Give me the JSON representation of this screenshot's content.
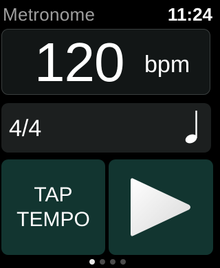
{
  "status_bar": {
    "app_title": "Metronome",
    "time": "11:24"
  },
  "tempo": {
    "value": "120",
    "unit": "bpm"
  },
  "time_signature": {
    "value": "4/4",
    "note_icon": "quarter-note-icon"
  },
  "controls": {
    "tap_tempo_line1": "TAP",
    "tap_tempo_line2": "TEMPO",
    "play_icon": "play-icon"
  },
  "pagination": {
    "page_count": 4,
    "active_page": 1
  },
  "colors": {
    "title_gray": "#9e9e9e",
    "button_teal": "#123530",
    "panel_dark": "#121616",
    "panel_gray": "#1c1f1f"
  }
}
